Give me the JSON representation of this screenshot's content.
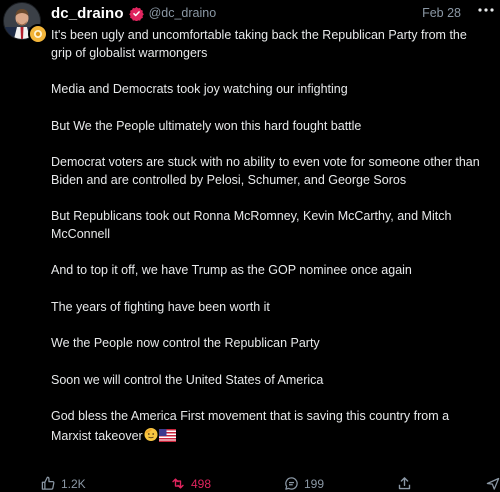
{
  "post": {
    "display_name": "dc_draino",
    "handle": "@dc_draino",
    "date": "Feb 28",
    "more_icon": "more-horizontal-icon",
    "paragraphs": [
      "It's been ugly and uncomfortable taking back the Republican Party from the grip of globalist warmongers",
      "Media and Democrats took joy watching our infighting",
      "But We the People ultimately won this hard fought battle",
      "Democrat voters are stuck with no ability to even vote for someone other than Biden and are controlled by Pelosi, Schumer, and George Soros",
      "But Republicans took out Ronna McRomney, Kevin McCarthy, and Mitch McConnell",
      "And to top it off, we have Trump as the GOP nominee once again",
      "The years of fighting have been worth it",
      "We the People now control the Republican Party",
      "Soon we will control the United States of America",
      "God bless the America First movement that is saving this country from a Marxist takeover"
    ],
    "final_emojis": [
      "saluting-face-emoji",
      "us-flag-emoji"
    ]
  },
  "actions": {
    "reply_count": "1.2K",
    "repost_count": "498",
    "comment_count": "199"
  },
  "colors": {
    "background": "#000000",
    "text": "#e7e9ea",
    "muted": "#8b98a5",
    "verified_red": "#e0245e",
    "repost_red": "#e0245e"
  }
}
